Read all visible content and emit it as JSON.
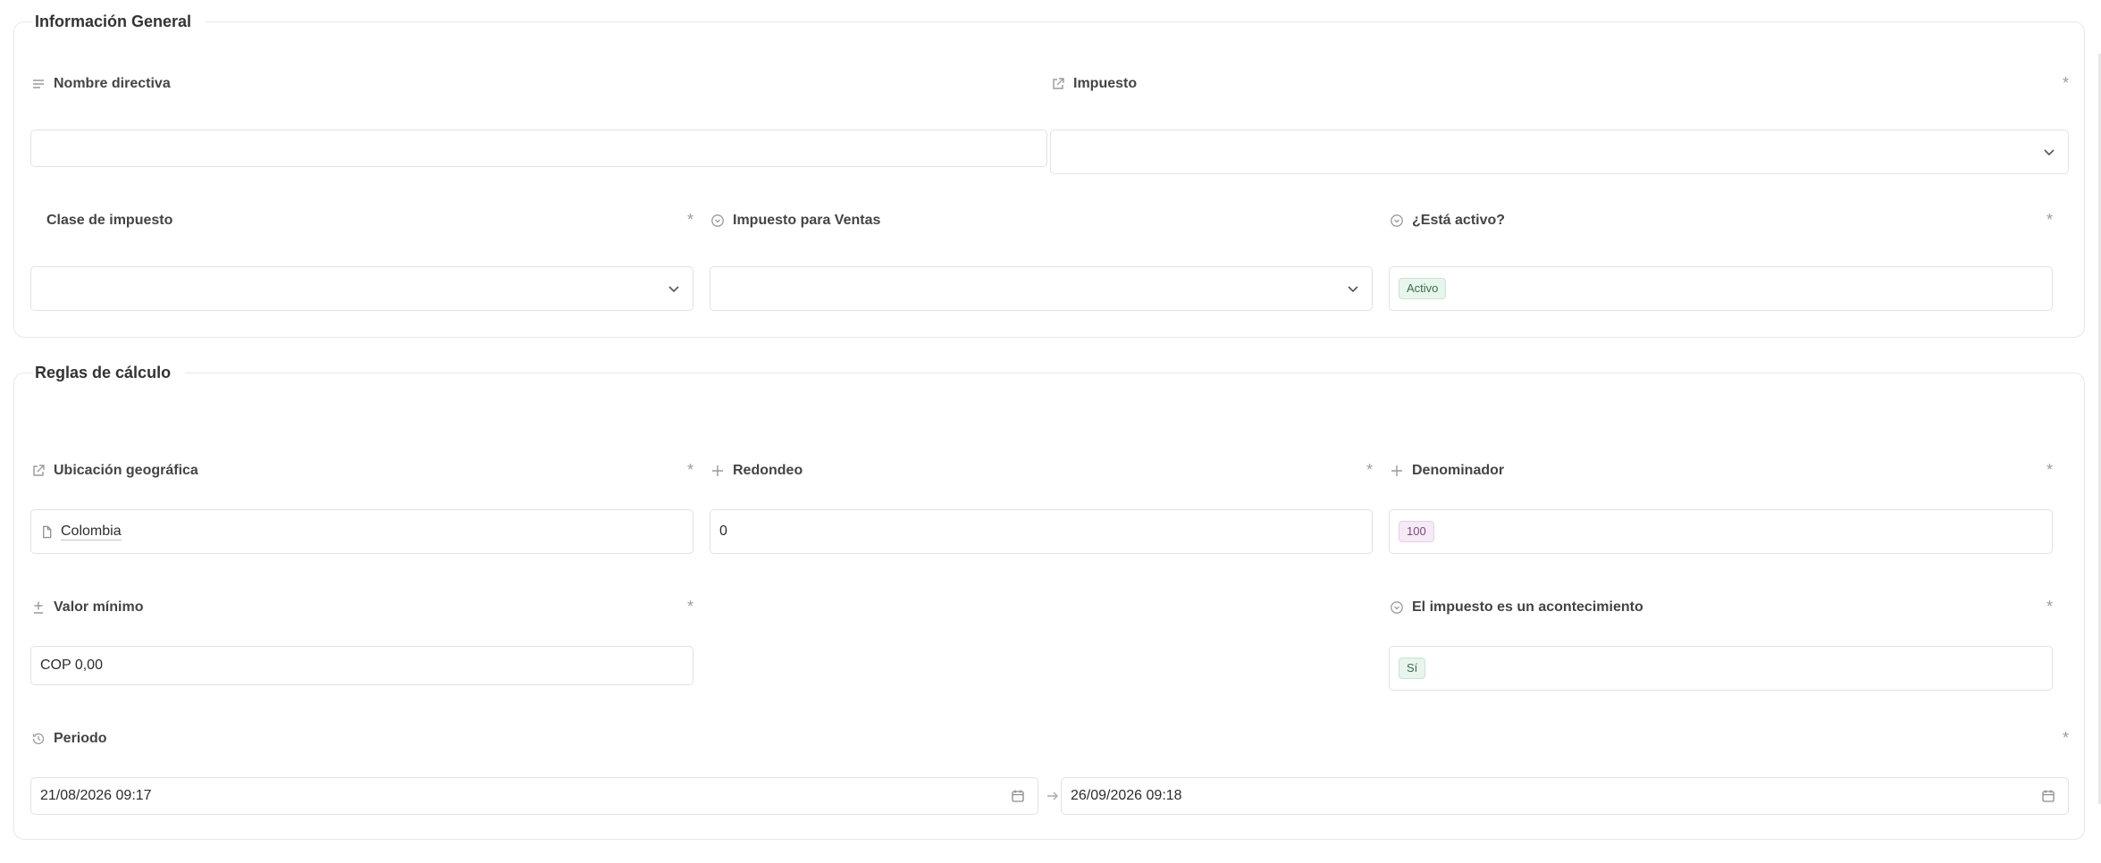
{
  "sections": {
    "general": {
      "title": "Información General",
      "fields": {
        "nombre": {
          "label": "Nombre directiva",
          "value": ""
        },
        "impuesto": {
          "label": "Impuesto",
          "required": "*",
          "value": ""
        },
        "clase": {
          "label": "Clase de impuesto",
          "required": "*",
          "value": ""
        },
        "ventas": {
          "label": "Impuesto para Ventas",
          "value": ""
        },
        "activo": {
          "label": "¿Está activo?",
          "required": "*",
          "value": "Activo"
        }
      }
    },
    "reglas": {
      "title": "Reglas de cálculo",
      "fields": {
        "ubicacion": {
          "label": "Ubicación geográfica",
          "required": "*",
          "value": "Colombia"
        },
        "redondeo": {
          "label": "Redondeo",
          "required": "*",
          "value": "0"
        },
        "denominador": {
          "label": "Denominador",
          "required": "*",
          "value": "100"
        },
        "minimo": {
          "label": "Valor mínimo",
          "required": "*",
          "value": "COP 0,00"
        },
        "acontecimiento": {
          "label": "El impuesto es un acontecimiento",
          "required": "*",
          "value": "Sí"
        },
        "periodo": {
          "label": "Periodo",
          "required": "*",
          "start": "21/08/2026 09:17",
          "end": "26/09/2026 09:18"
        }
      }
    }
  },
  "icons": {
    "nombre": "text-lines-icon",
    "impuesto": "external-link-icon",
    "ventas": "check-circle-icon",
    "activo": "check-circle-icon",
    "ubicacion": "external-link-icon",
    "redondeo": "plus-icon",
    "denominador": "plus-icon",
    "minimo": "plus-minus-icon",
    "acontecimiento": "check-circle-icon",
    "periodo": "history-icon"
  },
  "colors": {
    "tag_green_bg": "#e8f5ec",
    "tag_purple_bg": "#f5eaf6",
    "border": "#e2e2e2"
  }
}
